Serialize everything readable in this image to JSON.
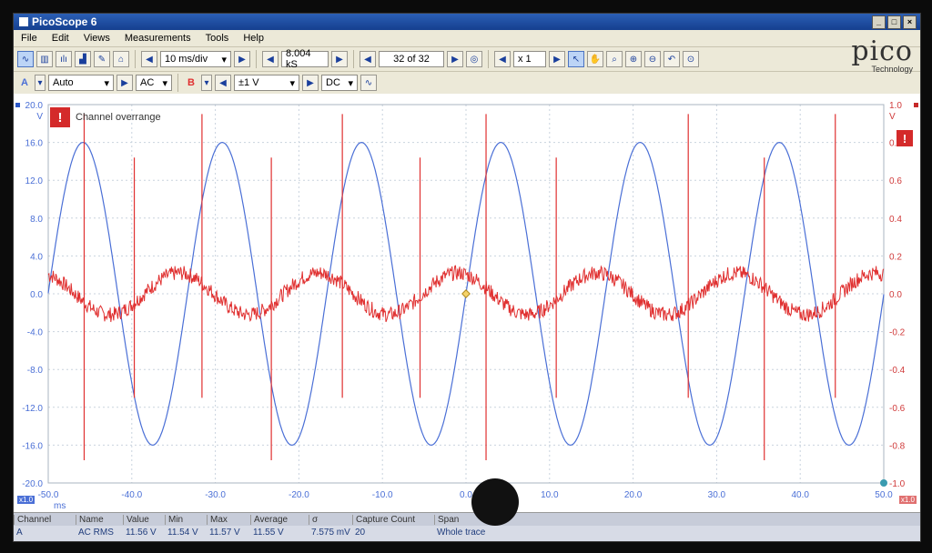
{
  "window": {
    "title": "PicoScope 6"
  },
  "menu": [
    "File",
    "Edit",
    "Views",
    "Measurements",
    "Tools",
    "Help"
  ],
  "toolbar": {
    "timebase": "10 ms/div",
    "samples": "8.004 kS",
    "capture": "32 of 32",
    "zoom": "x 1"
  },
  "channels": {
    "a": {
      "label": "A",
      "range": "Auto",
      "coupling": "AC",
      "color": "#4a6fd6"
    },
    "b": {
      "label": "B",
      "range": "±1 V",
      "coupling": "DC",
      "color": "#e03030"
    }
  },
  "logo": {
    "brand": "pico",
    "sub": "Technology"
  },
  "overrange": {
    "text": "Channel overrange"
  },
  "axes": {
    "left_unit": "V",
    "right_unit": "V",
    "x_unit": "ms",
    "left_ticks": [
      "20.0",
      "16.0",
      "12.0",
      "8.0",
      "4.0",
      "0.0",
      "-4.0",
      "-8.0",
      "-12.0",
      "-16.0",
      "-20.0"
    ],
    "right_ticks": [
      "1.0",
      "0.8",
      "0.6",
      "0.4",
      "0.2",
      "0.0",
      "-0.2",
      "-0.4",
      "-0.6",
      "-0.8",
      "-1.0"
    ],
    "x_ticks": [
      "-50.0",
      "-40.0",
      "-30.0",
      "-20.0",
      "-10.0",
      "0.0",
      "10.0",
      "20.0",
      "30.0",
      "40.0",
      "50.0"
    ],
    "left_scale_note": "x1.0",
    "right_scale_note": "x1.0"
  },
  "waveforms": {
    "a": {
      "amplitude_v": 16,
      "period_ms": 16.67,
      "phase_ms": 0
    },
    "b": {
      "amplitude_v": 0.2,
      "spike_times_ms": [
        -45.7,
        -39.7,
        -31.6,
        -23.3,
        -14.8,
        -5.5,
        2.4,
        10.8,
        26.6,
        35.7,
        44.2
      ]
    }
  },
  "measurements": {
    "headers": [
      "Channel",
      "Name",
      "Value",
      "Min",
      "Max",
      "Average",
      "σ",
      "Capture Count",
      "Span"
    ],
    "rows": [
      [
        "A",
        "AC RMS",
        "11.56 V",
        "11.54 V",
        "11.57 V",
        "11.55 V",
        "7.575 mV",
        "20",
        "Whole trace"
      ]
    ]
  }
}
